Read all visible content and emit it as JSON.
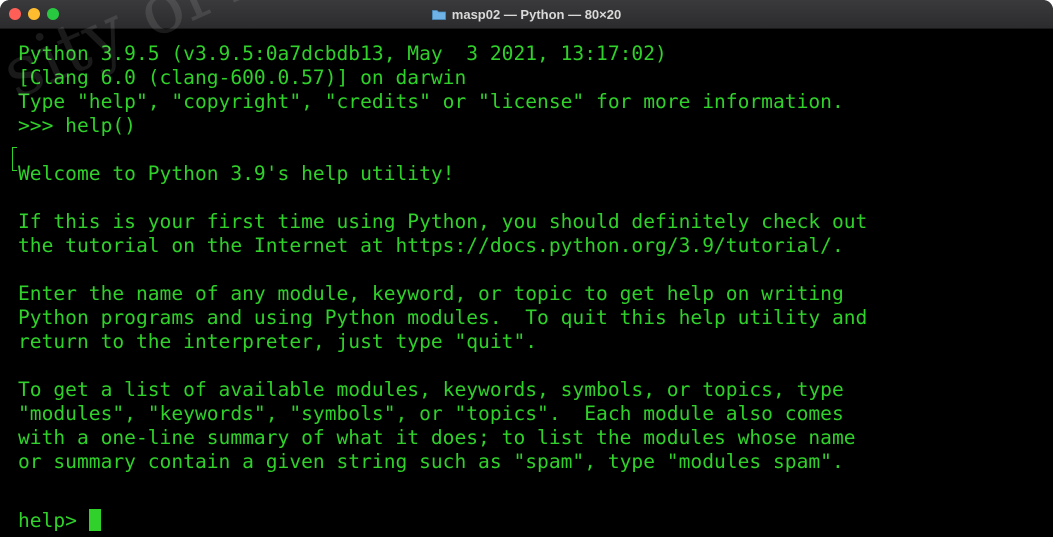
{
  "window": {
    "title": "masp02 — Python — 80×20"
  },
  "terminal": {
    "lines": [
      "Python 3.9.5 (v3.9.5:0a7dcbdb13, May  3 2021, 13:17:02)",
      "[Clang 6.0 (clang-600.0.57)] on darwin",
      "Type \"help\", \"copyright\", \"credits\" or \"license\" for more information.",
      ">>> help()",
      "",
      "Welcome to Python 3.9's help utility!",
      "",
      "If this is your first time using Python, you should definitely check out",
      "the tutorial on the Internet at https://docs.python.org/3.9/tutorial/.",
      "",
      "Enter the name of any module, keyword, or topic to get help on writing",
      "Python programs and using Python modules.  To quit this help utility and",
      "return to the interpreter, just type \"quit\".",
      "",
      "To get a list of available modules, keywords, symbols, or topics, type",
      "\"modules\", \"keywords\", \"symbols\", or \"topics\".  Each module also comes",
      "with a one-line summary of what it does; to list the modules whose name",
      "or summary contain a given string such as \"spam\", type \"modules spam\".",
      ""
    ],
    "prompt": "help> "
  },
  "colors": {
    "terminal_text": "#2fd12a",
    "terminal_bg": "#000000",
    "titlebar": "#2c2c2e"
  },
  "icons": {
    "title_icon": "folder-icon"
  },
  "watermark": {
    "text": "sity of Ap"
  }
}
